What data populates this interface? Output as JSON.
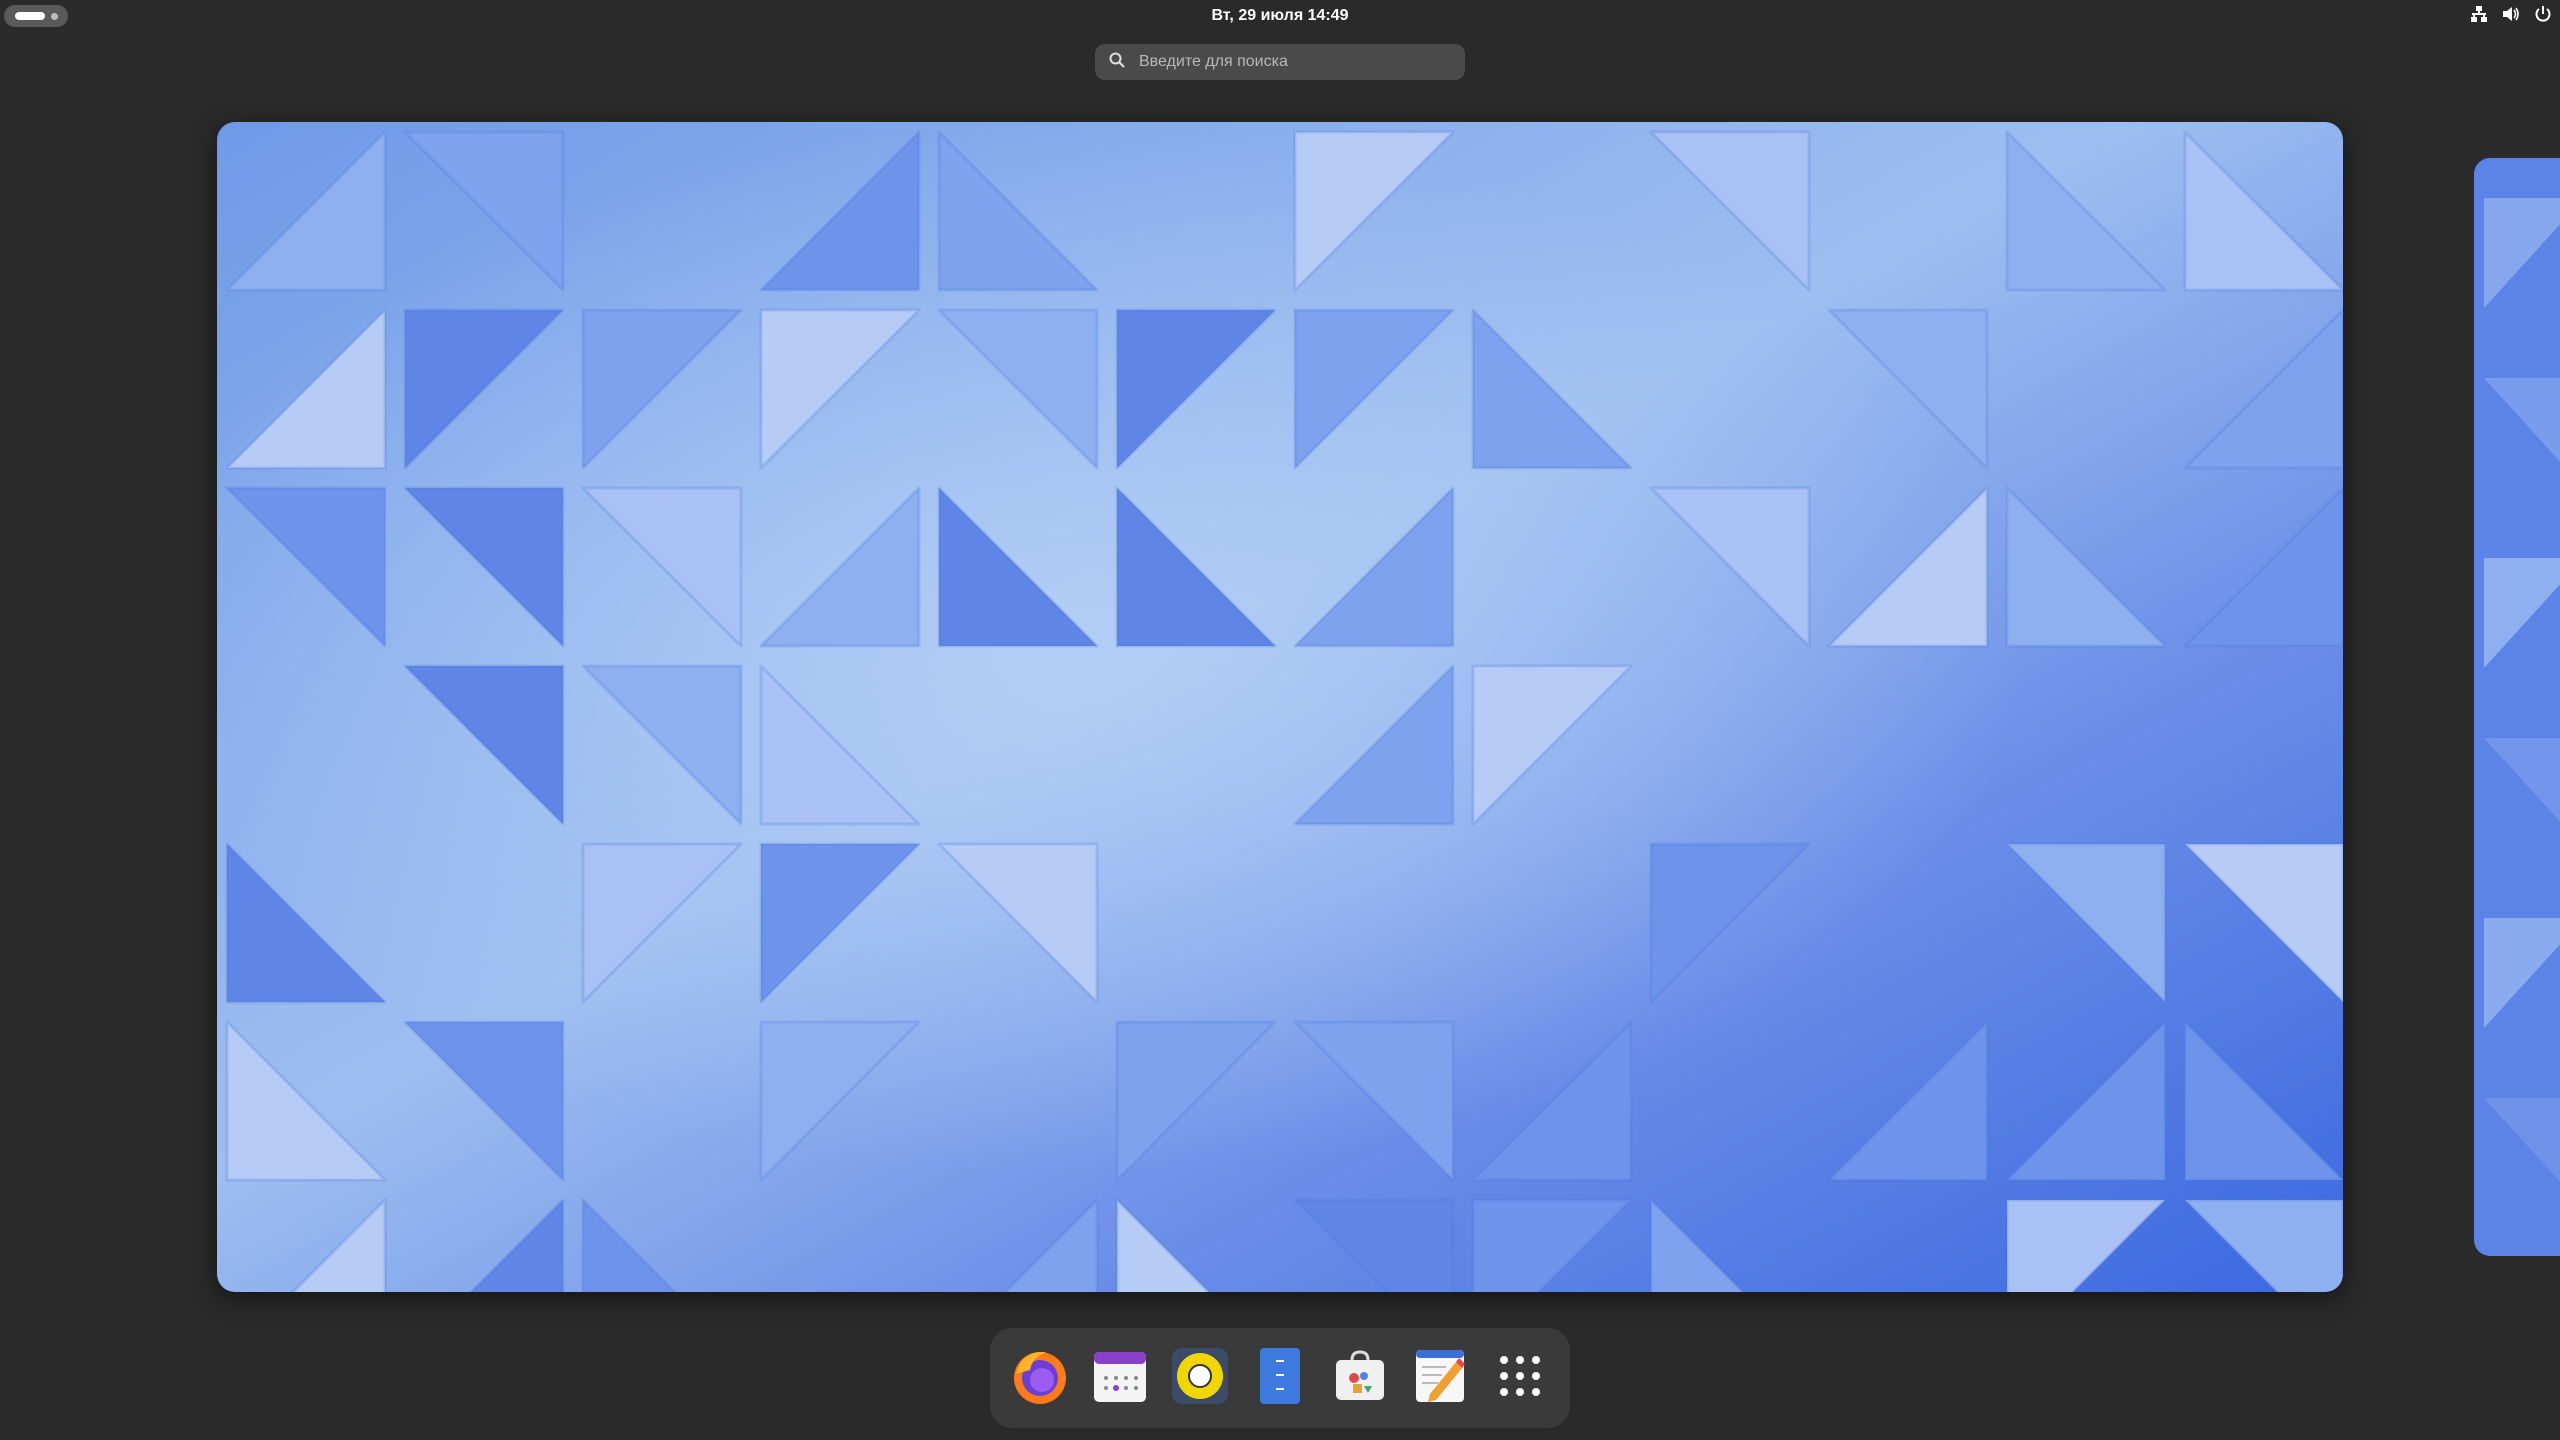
{
  "topbar": {
    "clock": "Вт, 29 июля  14:49",
    "tray_icons": [
      "network-icon",
      "volume-icon",
      "power-icon"
    ]
  },
  "search": {
    "placeholder": "Введите для поиска"
  },
  "dash": {
    "apps": [
      "firefox-icon",
      "calendar-icon",
      "rhythmbox-icon",
      "files-icon",
      "software-icon",
      "text-editor-icon",
      "app-grid-icon"
    ]
  },
  "colors": {
    "panel": "#2a2a2a",
    "search_bg": "#4a4a4a",
    "dash_bg": "#3a3a3a",
    "wallpaper_light": "#a9c4f5",
    "wallpaper_mid": "#6d97ec",
    "wallpaper_dark": "#3f6fe0"
  }
}
